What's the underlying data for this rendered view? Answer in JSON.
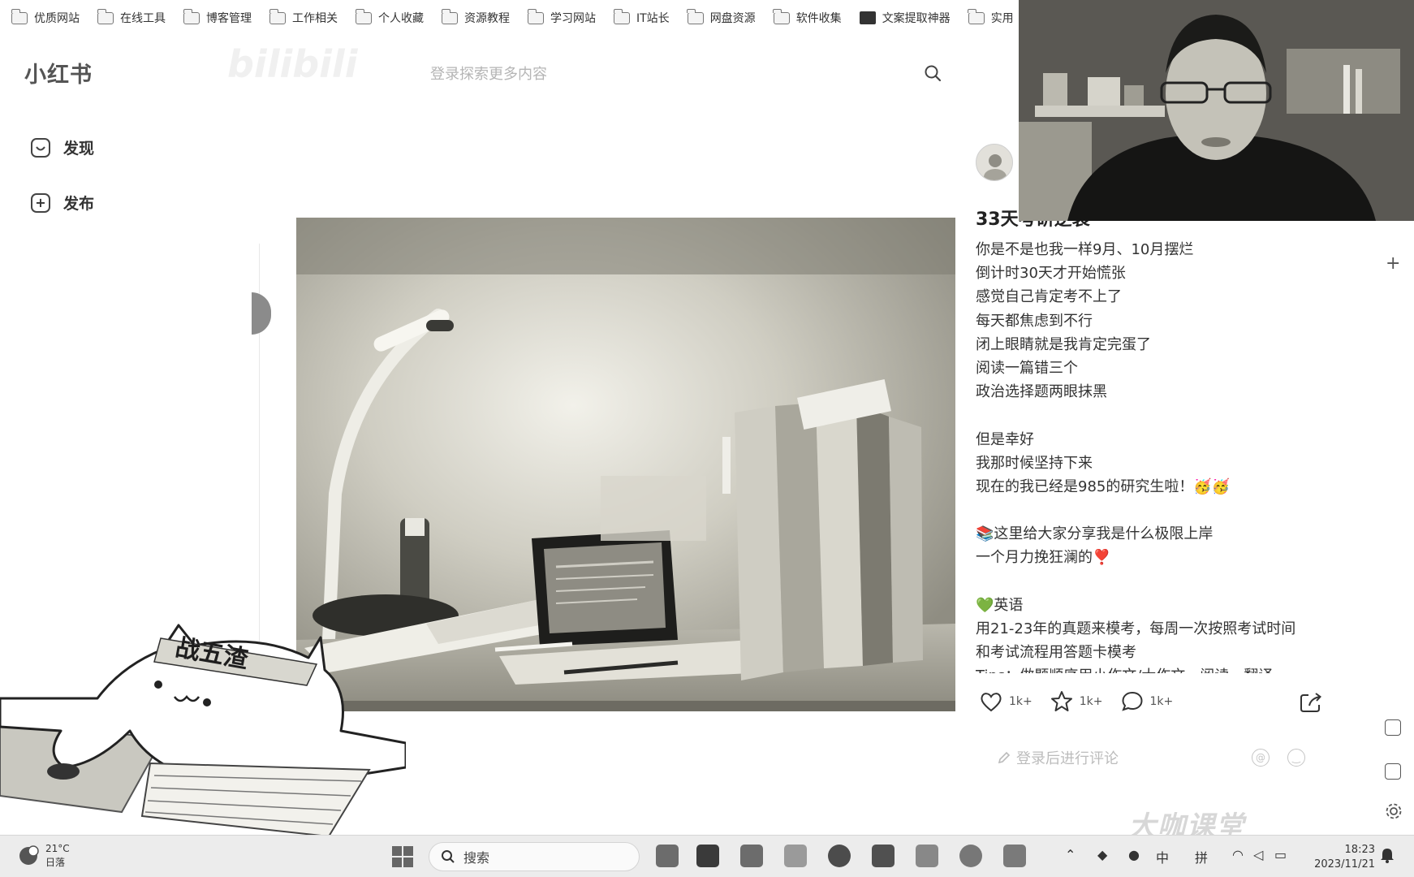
{
  "bookmarks": [
    "优质网站",
    "在线工具",
    "博客管理",
    "工作相关",
    "个人收藏",
    "资源教程",
    "学习网站",
    "IT站长",
    "网盘资源",
    "软件收集",
    "文案提取神器",
    "实用"
  ],
  "header": {
    "logo": "小红书",
    "watermark": "bilibili",
    "search_placeholder": "登录探索更多内容"
  },
  "nav": [
    {
      "label": "发现",
      "icon": "home-icon"
    },
    {
      "label": "发布",
      "icon": "plus-icon"
    }
  ],
  "note": {
    "title": "33天考研逆袭",
    "lines": [
      "你是不是也我一样9月、10月摆烂",
      "倒计时30天才开始慌张",
      "感觉自己肯定考不上了",
      "每天都焦虑到不行",
      "闭上眼睛就是我肯定完蛋了",
      "阅读一篇错三个",
      "政治选择题两眼抹黑",
      "",
      "但是幸好",
      "我那时候坚持下来",
      "现在的我已经是985的研究生啦！🥳🥳",
      "",
      "📚这里给大家分享我是什么极限上岸",
      "一个月力挽狂澜的❣️",
      "",
      "💚英语",
      "用21-23年的真题来模考，每周一次按照考试时间",
      "和考试流程用答题卡模考",
      "Tips：做题顺序用小作文/大作文—阅读—翻译—"
    ],
    "likes": "1k+",
    "collects": "1k+",
    "comments": "1k+",
    "comment_placeholder": "登录后进行评论"
  },
  "overlay": {
    "cat_headband": "战五渣",
    "brand_watermark": "大咖课堂"
  },
  "taskbar": {
    "temperature": "21°C",
    "weather": "日落",
    "search_label": "搜索",
    "ime_lang": "中",
    "ime_mode": "拼",
    "time": "18:23",
    "date": "2023/11/21"
  }
}
